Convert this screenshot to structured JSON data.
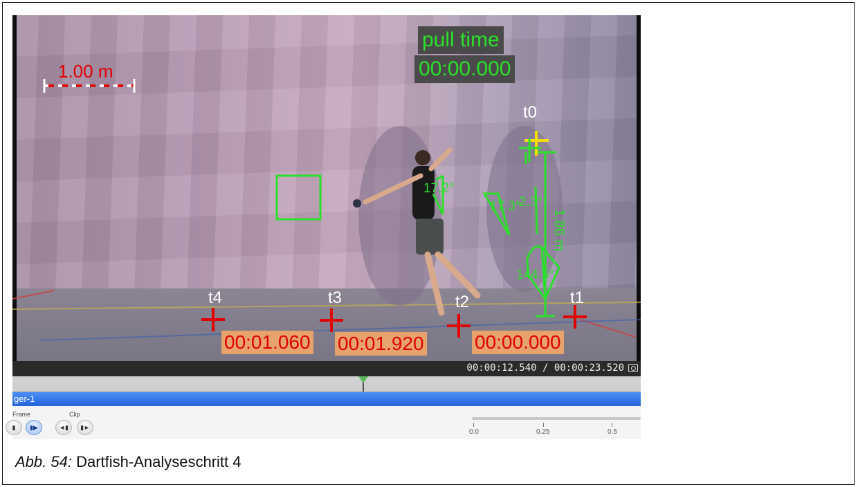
{
  "video": {
    "scale_label": "1.00 m",
    "pull_time_label": "pull time",
    "pull_time_value": "00:00.000",
    "markers": {
      "t0": "t0",
      "t1": "t1",
      "t2": "t2",
      "t3": "t3",
      "t4": "t4"
    },
    "times": {
      "t4": "00:01.060",
      "t3": "00:01.920",
      "t1": "00:00.000"
    },
    "angles": {
      "shoulder": "17.2°",
      "hip": "17.3°",
      "hip2": "2.3°",
      "knee": "144.5°"
    },
    "height": "1.86 m"
  },
  "status": {
    "timecode": "00:00:12.540 / 00:00:23.520"
  },
  "track": {
    "name": "ger-1"
  },
  "controls": {
    "frame_label": "Frame",
    "clip_label": "Clip",
    "speed_ticks": [
      "0.0",
      "0.25",
      "0.5"
    ]
  },
  "caption": {
    "prefix": "Abb. 54:",
    "text": " Dartfish-Analyseschritt 4"
  },
  "colors": {
    "overlay_green": "#2be02b",
    "marker_red": "#e00000",
    "time_bg": "#e7a36b",
    "track_blue": "#2563d9",
    "t0_yellow": "#f5e000"
  }
}
